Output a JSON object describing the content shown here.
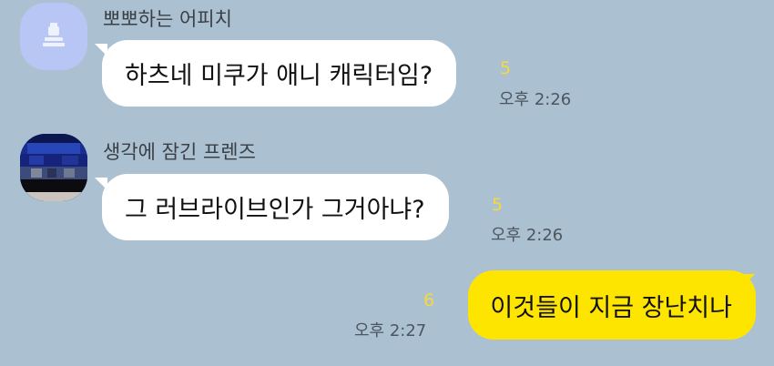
{
  "messages": [
    {
      "sender": "뽀뽀하는 어피치",
      "avatar_icon": "default-profile-icon",
      "text": "하츠네 미쿠가 애니 캐릭터임?",
      "unread": "5",
      "time": "오후 2:26"
    },
    {
      "sender": "생각에 잠긴 프렌즈",
      "avatar_icon": "pixelated-photo-icon",
      "text": "그 러브라이브인가 그거아냐?",
      "unread": "5",
      "time": "오후 2:26"
    },
    {
      "text": "이것들이 지금 장난치나",
      "unread": "6",
      "time": "오후 2:27"
    }
  ],
  "colors": {
    "background": "#abc1d1",
    "incoming_bubble": "#ffffff",
    "outgoing_bubble": "#fee500",
    "unread": "#f6d93a",
    "default_avatar": "#b7c6f5"
  }
}
